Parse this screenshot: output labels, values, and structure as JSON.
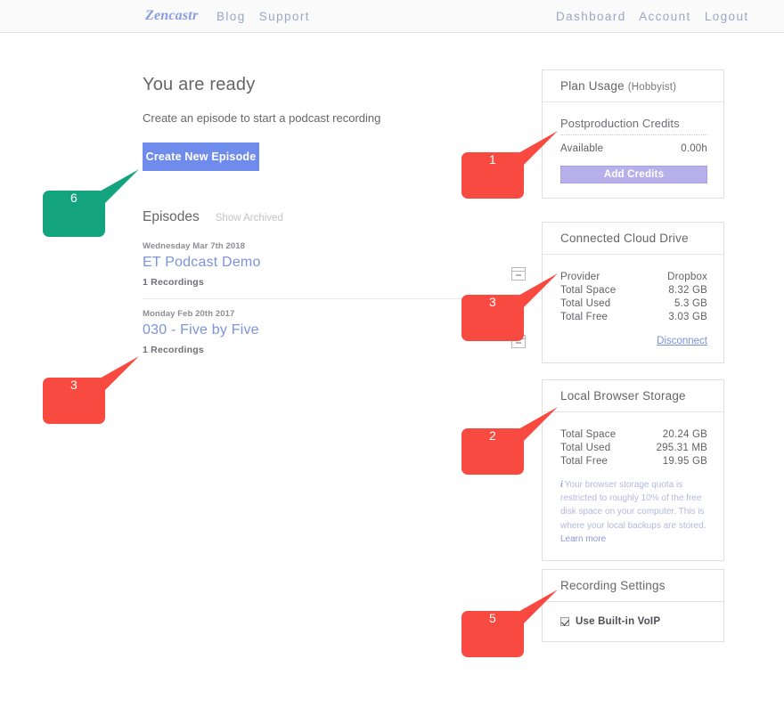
{
  "nav": {
    "brand": "Zencastr",
    "left_links": [
      "Blog",
      "Support"
    ],
    "right_links": [
      "Dashboard",
      "Account",
      "Logout"
    ]
  },
  "main": {
    "title": "You are ready",
    "subtitle": "Create an episode to start a podcast recording",
    "create_button": "Create New Episode",
    "episodes_heading": "Episodes",
    "show_archived": "Show Archived",
    "episodes": [
      {
        "date": "Wednesday Mar 7th 2018",
        "title": "ET Podcast Demo",
        "recordings": "1 Recordings"
      },
      {
        "date": "Monday Feb 20th 2017",
        "title": "030 - Five by Five",
        "recordings": "1 Recordings"
      }
    ]
  },
  "plan_panel": {
    "heading": "Plan Usage",
    "plan_name": "(Hobbyist)",
    "section_label": "Postproduction Credits",
    "available_label": "Available",
    "available_value": "0.00h",
    "add_credits_button": "Add Credits"
  },
  "cloud_panel": {
    "heading": "Connected Cloud Drive",
    "rows": [
      {
        "label": "Provider",
        "value": "Dropbox"
      },
      {
        "label": "Total Space",
        "value": "8.32 GB"
      },
      {
        "label": "Total Used",
        "value": "5.3 GB"
      },
      {
        "label": "Total Free",
        "value": "3.03 GB"
      }
    ],
    "disconnect": "Disconnect"
  },
  "local_panel": {
    "heading": "Local Browser Storage",
    "rows": [
      {
        "label": "Total Space",
        "value": "20.24 GB"
      },
      {
        "label": "Total Used",
        "value": "295.31 MB"
      },
      {
        "label": "Total Free",
        "value": "19.95 GB"
      }
    ],
    "info_icon": "i",
    "note": "Your browser storage quota is restricted to roughly 10% of the free disk space on your computer. This is where your local backups are stored.",
    "learn_more": "Learn more"
  },
  "recording_panel": {
    "heading": "Recording Settings",
    "voip_label": "Use Built-in VoIP",
    "voip_checked": true
  },
  "colors": {
    "callout_red": "#f94a41",
    "callout_green": "#14a37f",
    "primary_button": "#6f8cec",
    "credits_button": "#b8b0ea",
    "link_blue": "#7b92e0"
  },
  "callouts": [
    {
      "number": "1",
      "color": "#f94a41"
    },
    {
      "number": "6",
      "color": "#14a37f"
    },
    {
      "number": "3",
      "color": "#f94a41"
    },
    {
      "number": "3",
      "color": "#f94a41"
    },
    {
      "number": "2",
      "color": "#f94a41"
    },
    {
      "number": "5",
      "color": "#f94a41"
    }
  ]
}
